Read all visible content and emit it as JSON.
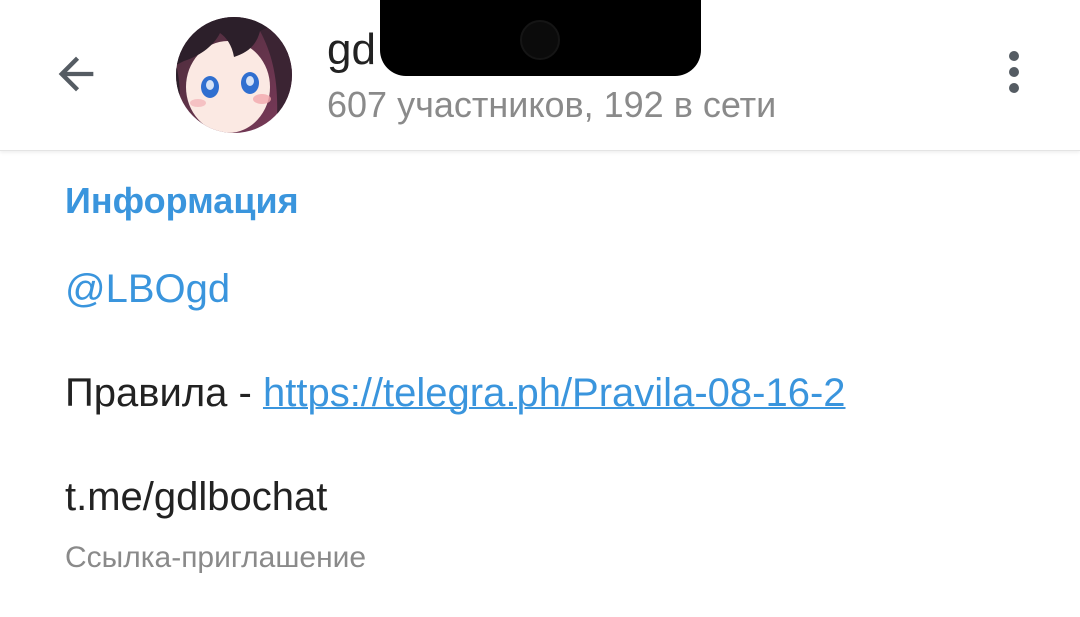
{
  "header": {
    "back_icon": "arrow-left-icon",
    "title_visible": "gd",
    "subtitle": "607 участников, 192 в сети",
    "more_icon": "more-vertical-icon",
    "avatar_icon": "anime-avatar"
  },
  "info": {
    "section_title": "Информация",
    "username": "@LBOgd",
    "rules_prefix": "Правила - ",
    "rules_link": "https://telegra.ph/Pravila-08-16-2",
    "invite_link": "t.me/gdlbochat",
    "invite_caption": "Ссылка-приглашение"
  },
  "colors": {
    "accent": "#3a95dd",
    "text_primary": "#222222",
    "text_secondary": "#8a8a8a"
  }
}
